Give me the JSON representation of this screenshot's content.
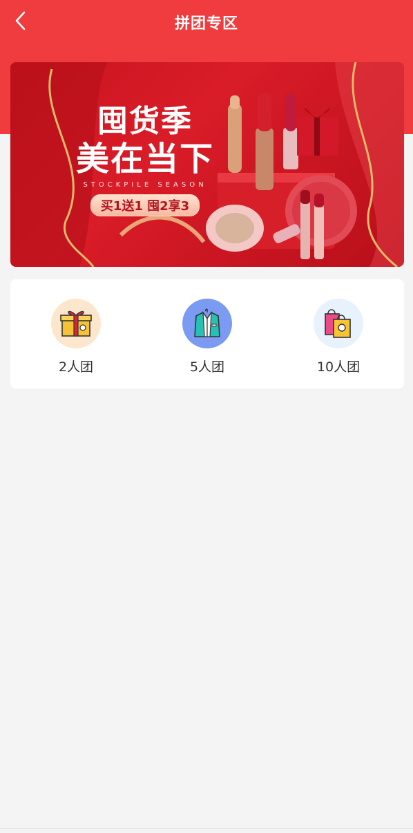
{
  "header": {
    "title": "拼团专区",
    "back_icon": "chevron-left-icon",
    "background_color": "#f03c3e"
  },
  "banner": {
    "title_line1": "囤货季",
    "title_line2": "美在当下",
    "subtitle": "STOCKPILE SEASON",
    "promo": "买1送1 囤2享3"
  },
  "groups": [
    {
      "label": "2人团",
      "icon": "gift-box-icon",
      "icon_bg": "#fde7cc"
    },
    {
      "label": "5人团",
      "icon": "suit-jacket-icon",
      "icon_bg": "#7b9af2"
    },
    {
      "label": "10人团",
      "icon": "shopping-bags-icon",
      "icon_bg": "#e8f2fd"
    }
  ]
}
